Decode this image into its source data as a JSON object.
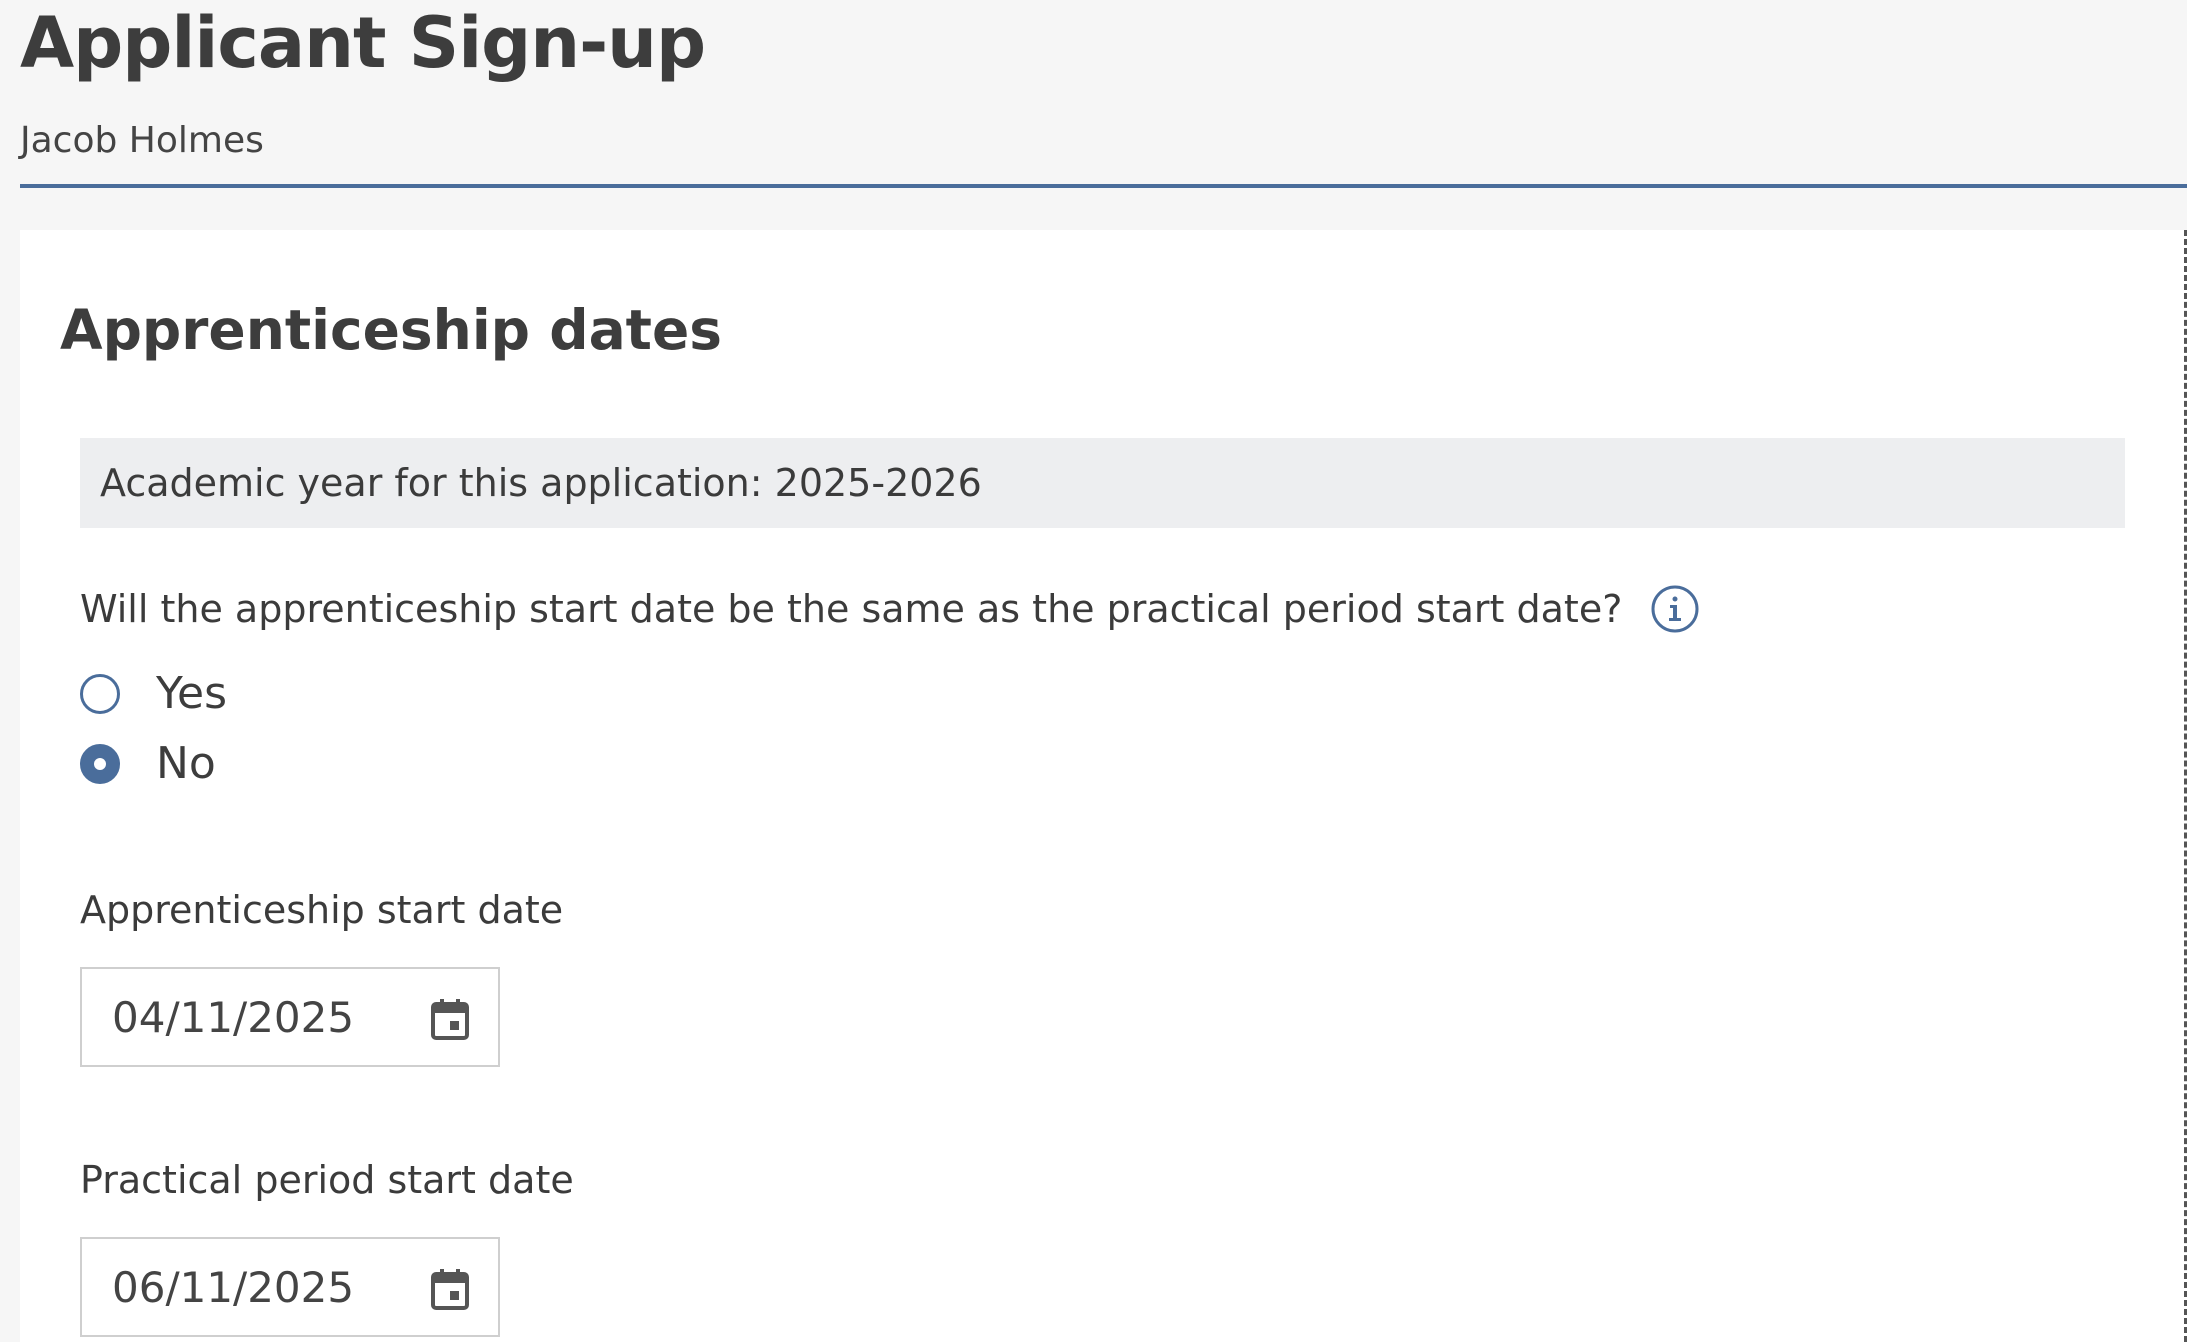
{
  "header": {
    "title": "Applicant Sign-up",
    "user_name": "Jacob Holmes"
  },
  "section": {
    "title": "Apprenticeship dates",
    "academic_year_banner": "Academic year for this application: 2025-2026",
    "question": "Will the apprenticeship start date be the same as the practical period start date?",
    "options": [
      {
        "label": "Yes",
        "selected": false
      },
      {
        "label": "No",
        "selected": true
      }
    ],
    "apprenticeship_start": {
      "label": "Apprenticeship start date",
      "value": "04/11/2025"
    },
    "practical_start": {
      "label": "Practical period start date",
      "value": "06/11/2025"
    }
  },
  "colors": {
    "accent": "#4a6d9b",
    "banner_bg": "#edeef0",
    "page_bg": "#f6f6f6"
  },
  "icons": {
    "info": "info-icon",
    "calendar": "calendar-icon"
  }
}
